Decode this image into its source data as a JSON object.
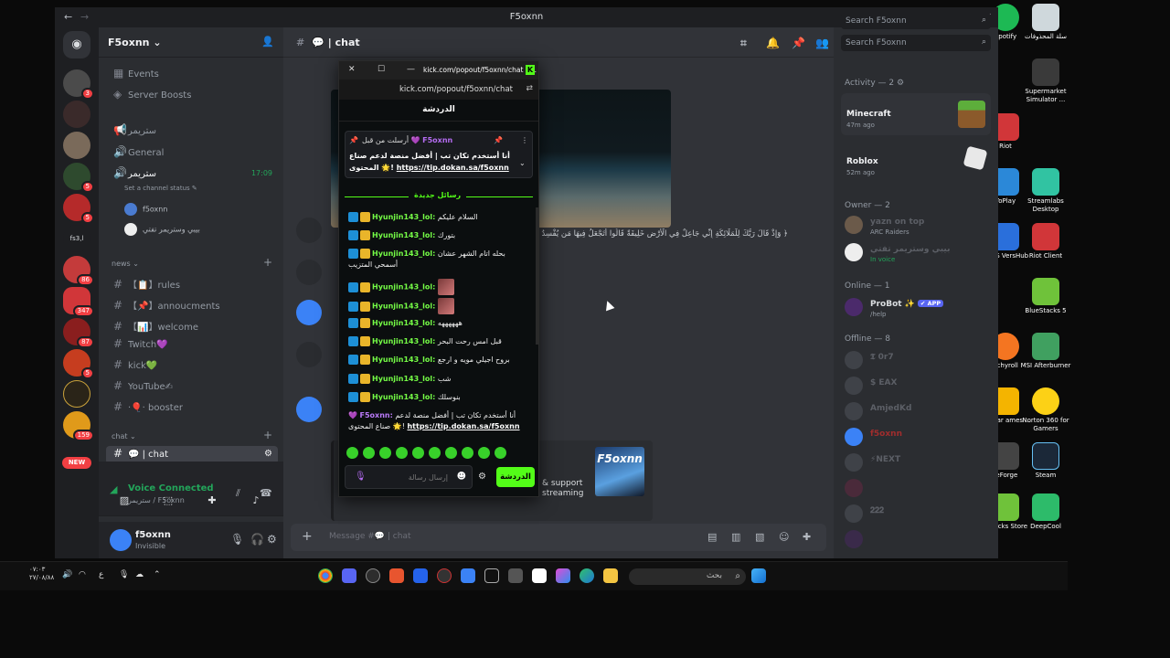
{
  "window": {
    "title": "F5oxnn",
    "back": "←",
    "forward": "→",
    "minimize": "—",
    "maximize": "☐",
    "close": "✕"
  },
  "rail": {
    "badges": [
      "3",
      "5",
      "5",
      "86",
      "347",
      "87",
      "5",
      "159"
    ],
    "text_server": "fs3,l",
    "new_label": "NEW"
  },
  "sidebar": {
    "server_name": "F5oxnn",
    "events": "Events",
    "boosts": "Server Boosts",
    "stream_channel": "ستريمر",
    "general": "General",
    "voice_channel": "ستريمر",
    "voice_time": "17:09",
    "voice_status_prompt": "Set a channel status",
    "voice_users": [
      "f5oxnn",
      "بيبي وستريمر تفتي"
    ],
    "cat_news": "news",
    "news_channels": [
      "【📋】rules",
      "【📌】annoucments",
      "【📊】welcome",
      "Twitch💜",
      "kick💚",
      "YouTube✍",
      "·🎈· booster"
    ],
    "cat_chat": "chat",
    "active_channel": "💬 | chat"
  },
  "voice_panel": {
    "title": "Voice Connected",
    "subtitle": "ستريمر / F5oxnn"
  },
  "user_panel": {
    "name": "f5oxnn",
    "status": "Invisible"
  },
  "main": {
    "channel": "💬 | chat",
    "ayah": "﴿ وَإِذْ قَالَ رَبُّكَ لِلْمَلَائِكَةِ إِنِّي جَاعِلٌ فِي الْأَرْضِ خَلِيفَةً قَالُوا أَتَجْعَلُ فِيهَا مَن يُفْسِدُ فِيهَا وَيَسْفِكُ الدِّمَاءَ ﴾",
    "embed_text_1": "& support",
    "embed_text_2": "streaming",
    "embed_thumb": "F5oxnn",
    "composer_placeholder": "Message #💬 | chat"
  },
  "members": {
    "search_placeholder": "Search F5oxnn",
    "activity_header": "Activity — 2",
    "activities": [
      {
        "game": "Minecraft",
        "time": "47m ago"
      },
      {
        "game": "Roblox",
        "time": "52m ago"
      }
    ],
    "owner_header": "Owner — 2",
    "owners": [
      {
        "name": "yazn on top",
        "sub": "ARC Raiders"
      },
      {
        "name": "بيبي وستريمر تفتي",
        "sub": "In voice"
      }
    ],
    "online_header": "Online — 1",
    "online": [
      {
        "name": "ProBot ✨",
        "tag": "✔ APP",
        "sub": "/help"
      }
    ],
    "offline_header": "Offline — 8",
    "offline": [
      "𝕿 0r7",
      "$ EAX",
      "AmjedKd",
      "f5oxnn",
      "⚡NEXT",
      "",
      "𝟐𝟐𝟐",
      ""
    ]
  },
  "kick": {
    "window_title": "kick.com/popout/f5oxnn/chat - ...",
    "url": "kick.com/popout/f5oxnn/chat",
    "chat_header": "الدردشة",
    "pinned_header": "أرسلت من قبل",
    "pinned_user": "F5oxnn",
    "pinned_text": "أنا أستخدم تكان تب | أفضل منصة لدعم صناع المحتوى 🌟!",
    "pinned_link": "https://tip.dokan.sa/f5oxnn",
    "new_messages": "رسائل جديدة",
    "messages": [
      {
        "user": "Hyunjin143_lol:",
        "text": "السلام عليكم"
      },
      {
        "user": "Hyunjin143_lol:",
        "text": "بتورك"
      },
      {
        "user": "Hyunjin143_lol:",
        "text": "بحله اتام الشهر عشان أسمحي المتزيب"
      },
      {
        "user": "Hyunjin143_lol:",
        "text": ""
      },
      {
        "user": "Hyunjin143_lol:",
        "text": ""
      },
      {
        "user": "Hyunjin143_lol:",
        "text": "ههههههه"
      },
      {
        "user": "Hyunjin143_lol:",
        "text": "قبل امس رحت البحر"
      },
      {
        "user": "Hyunjin143_lol:",
        "text": "بروح اجيلي مويه و ارجع"
      },
      {
        "user": "Hyunjin143_lol:",
        "text": "شب"
      },
      {
        "user": "Hyunjin143_lol:",
        "text": "بنوسلك"
      }
    ],
    "last_user": "F5oxnn:",
    "last_text": "أنا أستخدم تكان تب | أفضل منصة لدعم صناع المحتوى 🌟!",
    "last_link": "https://tip.dokan.sa/f5oxnn",
    "input_placeholder": "إرسال رسالة",
    "send": "الدردشة"
  },
  "desktop_icons": [
    {
      "label": "Spotify",
      "color": "#1db954"
    },
    {
      "label": "سلة المحذوفات",
      "color": "#cfd8dc"
    },
    {
      "label": "Supermarket Simulator ...",
      "color": "#3a3a3a"
    },
    {
      "label": "Riot",
      "color": "#d13639"
    },
    {
      "label": "YoPlay",
      "color": "#2b88d8"
    },
    {
      "label": "Streamlabs Desktop",
      "color": "#31c3a2"
    },
    {
      "label": "ASUS VersHub",
      "color": "#2a6fdb"
    },
    {
      "label": "Riot Client",
      "color": "#d13639"
    },
    {
      "label": "BlueStacks 5",
      "color": "#6fc23a"
    },
    {
      "label": "nchyroll",
      "color": "#f47521"
    },
    {
      "label": "MSI Afterburner",
      "color": "#40a060"
    },
    {
      "label": "ockstar ames ...",
      "color": "#f4b400"
    },
    {
      "label": "Norton 360 for Gamers",
      "color": "#fcd116"
    },
    {
      "label": "reForge",
      "color": "#444"
    },
    {
      "label": "Steam",
      "color": "#1b2838"
    },
    {
      "label": "eStacks Store",
      "color": "#6fc23a"
    },
    {
      "label": "DeepCool",
      "color": "#2dbb6a"
    }
  ],
  "taskbar": {
    "search": "بحث",
    "time": "٠٧:٠٣",
    "date": "٢٧/٠٨/٨٨",
    "lang": "ع"
  }
}
